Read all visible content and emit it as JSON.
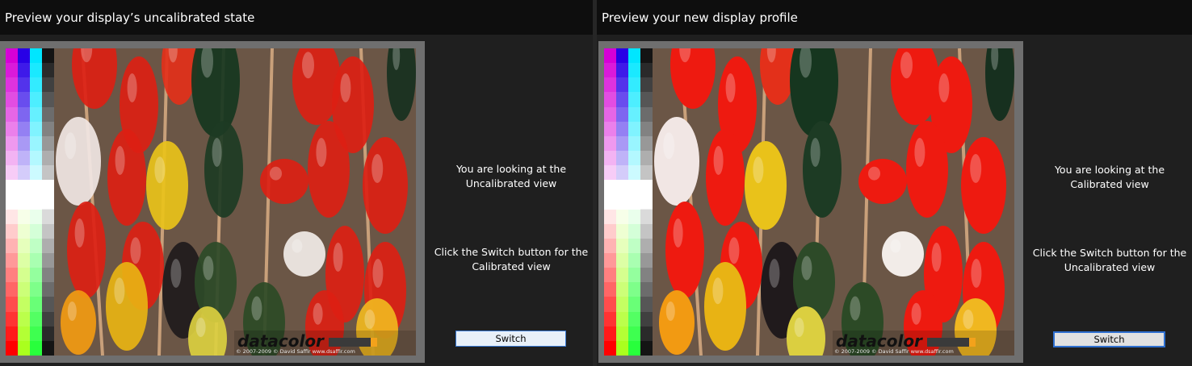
{
  "left_panel": {
    "title": "Preview your display’s uncalibrated state",
    "message_line1": "You are looking at the",
    "message_line2": "Uncalibrated view",
    "hint_line1": "Click the Switch button for the",
    "hint_line2": "Calibrated view",
    "switch_label": "Switch",
    "image": {
      "brand_logo": "datacolor",
      "copyright": "© 2007-2009 © David Saffir www.dsaffir.com"
    }
  },
  "right_panel": {
    "title": "Preview your new display profile",
    "message_line1": "You are looking at the",
    "message_line2": "Calibrated view",
    "hint_line1": "Click the Switch button for the",
    "hint_line2": "Uncalibrated view",
    "switch_label": "Switch",
    "image": {
      "brand_logo": "datacolor",
      "copyright": "© 2007-2009 © David Saffir www.dsaffir.com"
    }
  },
  "colors": {
    "title_bar": "#0e0e0e",
    "panel_bg": "#1f1f1f",
    "frame": "#6f6f6f",
    "button_border": "#3a7bd5"
  }
}
